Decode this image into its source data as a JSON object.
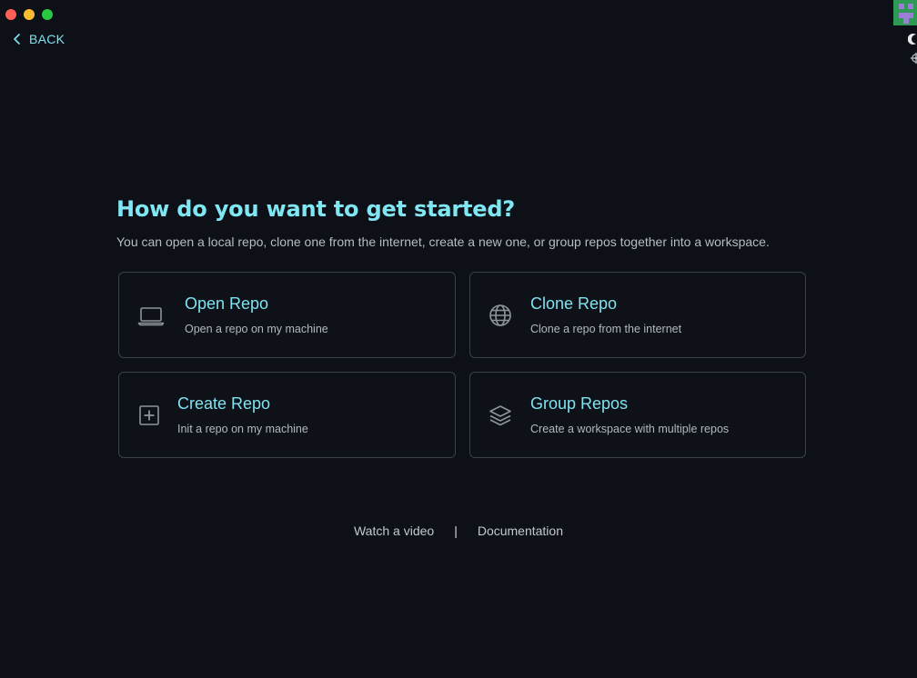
{
  "nav": {
    "back_label": "BACK"
  },
  "colors": {
    "close": "#ff5f57",
    "minimize": "#febc2e",
    "maximize": "#28c840",
    "accent": "#7fe3f0",
    "background": "#0d1017"
  },
  "header": {
    "title": "How do you want to get started?",
    "subtitle": "You can open a local repo, clone one from the internet, create a new one, or group repos together into a workspace."
  },
  "options": [
    {
      "title": "Open Repo",
      "description": "Open a repo on my machine",
      "icon": "laptop-icon"
    },
    {
      "title": "Clone Repo",
      "description": "Clone a repo from the internet",
      "icon": "globe-icon"
    },
    {
      "title": "Create Repo",
      "description": "Init a repo on my machine",
      "icon": "plus-square-icon"
    },
    {
      "title": "Group Repos",
      "description": "Create a workspace with multiple repos",
      "icon": "layers-icon"
    }
  ],
  "footer": {
    "video_label": "Watch a video",
    "separator": "|",
    "docs_label": "Documentation"
  }
}
